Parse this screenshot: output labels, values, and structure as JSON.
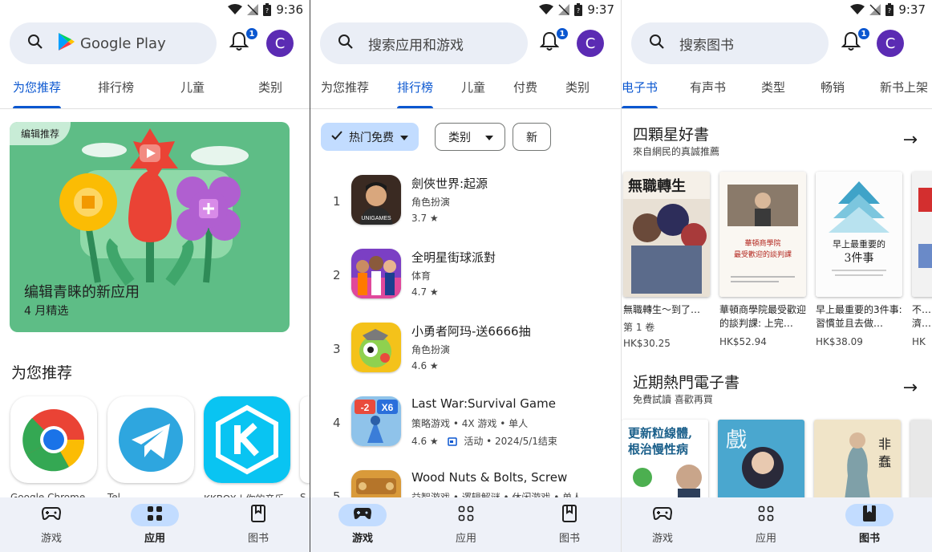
{
  "status_bar": [
    {
      "time": "9:36"
    },
    {
      "time": "9:37"
    },
    {
      "time": "9:37"
    }
  ],
  "panel1": {
    "search_label": "Google Play",
    "notif_count": "1",
    "avatar_letter": "C",
    "tabs": [
      "为您推荐",
      "排行榜",
      "儿童",
      "类别"
    ],
    "hero": {
      "tag": "编辑推荐",
      "title": "编辑青睐的新应用",
      "subtitle": "4 月精选"
    },
    "section_title": "为您推荐",
    "apps": [
      "Google Chrome",
      "Tel…",
      "KKBOX | 你的音乐…",
      "S"
    ],
    "nav": [
      "游戏",
      "应用",
      "图书"
    ]
  },
  "panel2": {
    "search_placeholder": "搜索应用和游戏",
    "notif_count": "1",
    "avatar_letter": "C",
    "tabs": [
      "为您推荐",
      "排行榜",
      "儿童",
      "付费",
      "类别"
    ],
    "chips": {
      "hot_free": "热门免费",
      "category": "类别",
      "new": "新"
    },
    "rows": [
      {
        "rank": "1",
        "name": "劍俠世界:起源",
        "category": "角色扮演",
        "rating": "3.7 ★"
      },
      {
        "rank": "2",
        "name": "全明星街球派對",
        "category": "体育",
        "rating": "4.7 ★"
      },
      {
        "rank": "3",
        "name": "小勇者阿玛-送6666抽",
        "category": "角色扮演",
        "rating": "4.6 ★"
      },
      {
        "rank": "4",
        "name": "Last War:Survival Game",
        "category": "策略游戏 • 4X 游戏 • 单人",
        "rating": "4.6 ★",
        "event": "活动 • 2024/5/1结束"
      },
      {
        "rank": "5",
        "name": "Wood Nuts & Bolts, Screw",
        "category": "益智游戏 • 逻辑解谜 • 休闲游戏 • 单人",
        "rating": ""
      }
    ],
    "nav": [
      "游戏",
      "应用",
      "图书"
    ]
  },
  "panel3": {
    "search_placeholder": "搜索图书",
    "notif_count": "1",
    "avatar_letter": "C",
    "tabs": [
      "电子书",
      "有声书",
      "类型",
      "畅销",
      "新书上架"
    ],
    "shelf1": {
      "title": "四顆星好書",
      "subtitle": "來自網民的真誠推薦",
      "books": [
        {
          "title": "無職轉生～到了…",
          "extra": "第 1 卷",
          "price": "HK$30.25",
          "cover_text": "無職轉生"
        },
        {
          "title": "華頓商學院最受歡迎的談判課: 上完…",
          "price": "HK$52.94",
          "cover_text": "華頓商學院 最受歡迎的談判課"
        },
        {
          "title": "早上最重要的3件事: 習慣並且去做…",
          "price": "HK$38.09",
          "cover_text": "早上最重要的 3件事"
        },
        {
          "title": "不…濟…",
          "price": "HK"
        }
      ]
    },
    "shelf2": {
      "title": "近期熱門電子書",
      "subtitle": "免費試讀 喜歡再買",
      "books": [
        {
          "cover_text": "更新粒線體，根治慢性病"
        },
        {
          "cover_text": "戲"
        },
        {
          "cover_text": "非 蠢 非 …"
        }
      ]
    },
    "nav": [
      "游戏",
      "应用",
      "图书"
    ]
  },
  "colors": {
    "accent": "#0b57d0",
    "search_bg": "#eaeef6",
    "nav_bg": "#eef1f8",
    "pill": "#c2dcff",
    "hero_green": "#5ebd86",
    "avatar": "#5b2bb3"
  }
}
